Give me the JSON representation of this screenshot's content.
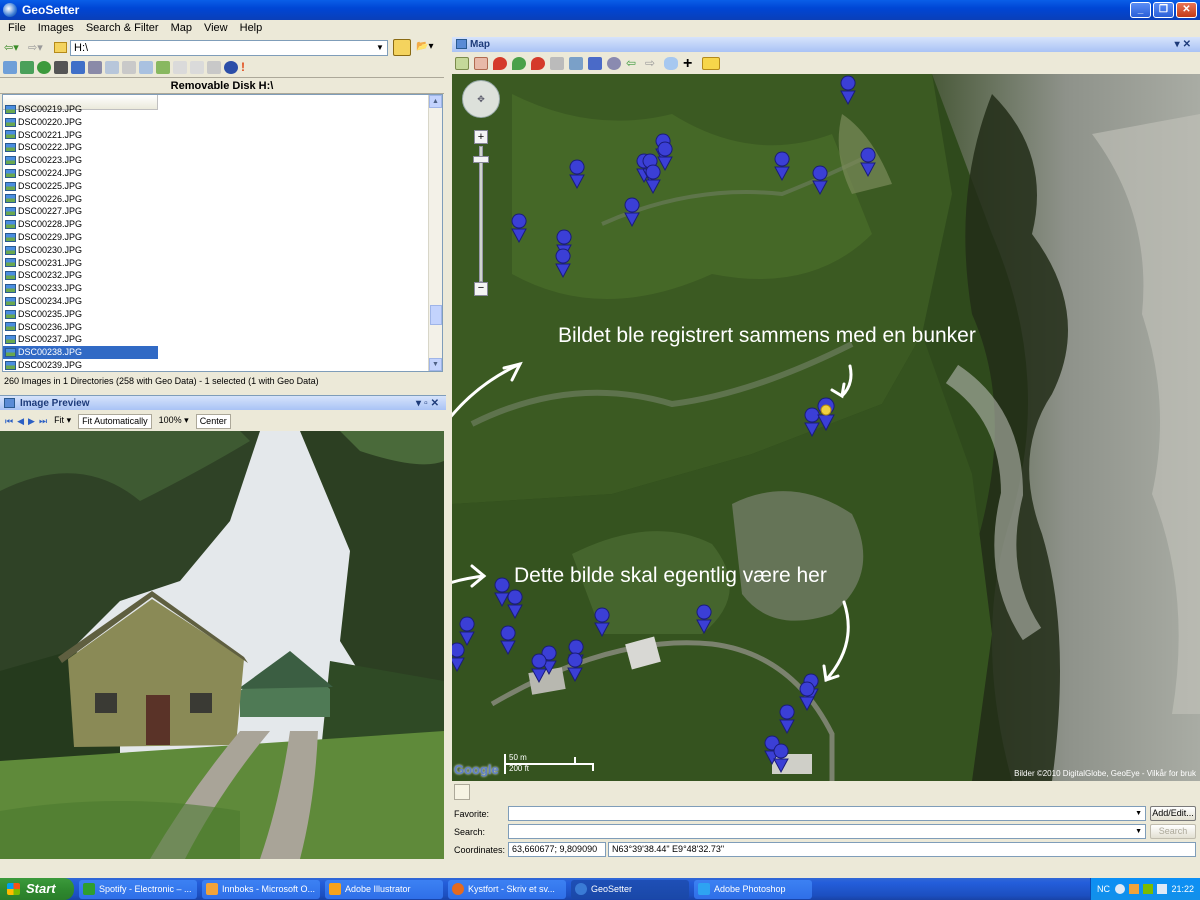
{
  "window": {
    "title": "GeoSetter"
  },
  "menu": [
    "File",
    "Images",
    "Search & Filter",
    "Map",
    "View",
    "Help"
  ],
  "address": {
    "value": "H:\\"
  },
  "browser": {
    "title": "Removable Disk H:\\"
  },
  "files": [
    "DSC00219.JPG",
    "DSC00220.JPG",
    "DSC00221.JPG",
    "DSC00222.JPG",
    "DSC00223.JPG",
    "DSC00224.JPG",
    "DSC00225.JPG",
    "DSC00226.JPG",
    "DSC00227.JPG",
    "DSC00228.JPG",
    "DSC00229.JPG",
    "DSC00230.JPG",
    "DSC00231.JPG",
    "DSC00232.JPG",
    "DSC00233.JPG",
    "DSC00234.JPG",
    "DSC00235.JPG",
    "DSC00236.JPG",
    "DSC00237.JPG",
    "DSC00238.JPG",
    "DSC00239.JPG"
  ],
  "selected_file": "DSC00238.JPG",
  "status": "260 Images in 1 Directories (258 with Geo Data) - 1 selected (1 with Geo Data)",
  "preview": {
    "title": "Image Preview",
    "fit_label": "Fit",
    "fit_auto_label": "Fit Automatically",
    "zoom": "100%",
    "center_label": "Center"
  },
  "map": {
    "title": "Map",
    "annotation_top": "Bildet ble registrert sammens med en bunker",
    "annotation_bottom": "Dette bilde skal egentlig være her",
    "scale_m": "50 m",
    "scale_ft": "200 ft",
    "attribution": "Bilder ©2010 DigitalGlobe, GeoEye - Vilkår for bruk",
    "logo": "Google"
  },
  "fields": {
    "favorite_label": "Favorite:",
    "search_label": "Search:",
    "coordinates_label": "Coordinates:",
    "add_edit_label": "Add/Edit...",
    "search_button_label": "Search",
    "coord_decimal": "63,660677; 9,809090",
    "coord_dms": "N63°39'38.44\" E9°48'32.73\""
  },
  "taskbar": {
    "start_label": "Start",
    "tasks": [
      {
        "label": "Spotify - Electronic – ...",
        "color": "#2f9e2f"
      },
      {
        "label": "Innboks - Microsoft O...",
        "color": "#f2a33a"
      },
      {
        "label": "Adobe Illustrator",
        "color": "#f7a21b"
      },
      {
        "label": "Kystfort - Skriv et sv...",
        "color": "#e56a1f"
      },
      {
        "label": "GeoSetter",
        "color": "#3a7bd5"
      },
      {
        "label": "Adobe Photoshop",
        "color": "#2ea3f2"
      }
    ],
    "tray_lang": "NC",
    "clock": "21:22"
  },
  "colors": {
    "marker": "#3b3fd6",
    "selection": "#316ac5"
  }
}
